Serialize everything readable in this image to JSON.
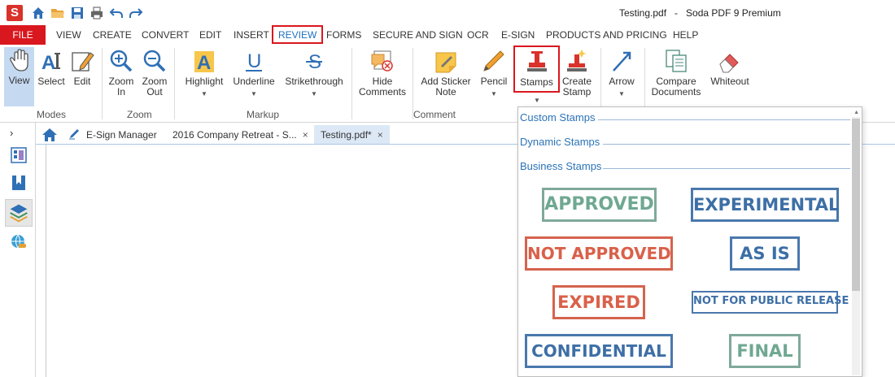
{
  "titlebar": {
    "logo": "S",
    "doc_title": "Testing.pdf   -   Soda PDF 9 Premium"
  },
  "menu": {
    "file": "FILE",
    "items": [
      "VIEW",
      "CREATE",
      "CONVERT",
      "EDIT",
      "INSERT",
      "REVIEW",
      "FORMS",
      "SECURE AND SIGN",
      "OCR",
      "E-SIGN",
      "PRODUCTS AND PRICING",
      "HELP"
    ],
    "active": "REVIEW"
  },
  "ribbon": {
    "view": "View",
    "select": "Select",
    "edit": "Edit",
    "zoom_in": [
      "Zoom",
      "In"
    ],
    "zoom_out": [
      "Zoom",
      "Out"
    ],
    "highlight": "Highlight",
    "underline": "Underline",
    "strikethrough": "Strikethrough",
    "hide_comments": [
      "Hide",
      "Comments"
    ],
    "add_sticker": [
      "Add Sticker",
      "Note"
    ],
    "pencil": "Pencil",
    "stamps": "Stamps",
    "create_stamp": [
      "Create",
      "Stamp"
    ],
    "arrow": "Arrow",
    "compare": [
      "Compare",
      "Documents"
    ],
    "whiteout": "Whiteout",
    "groups": {
      "modes": "Modes",
      "zoom": "Zoom",
      "markup": "Markup",
      "comment": "Comment"
    }
  },
  "tabs": {
    "esign": "E-Sign Manager",
    "retreat": "2016 Company Retreat - S...",
    "testing": "Testing.pdf*",
    "close": "×"
  },
  "stamps_dropdown": {
    "sections": [
      "Custom Stamps",
      "Dynamic Stamps",
      "Business Stamps"
    ],
    "stamps": [
      "APPROVED",
      "EXPERIMENTAL",
      "NOT APPROVED",
      "AS IS",
      "EXPIRED",
      "NOT FOR PUBLIC RELEASE",
      "CONFIDENTIAL",
      "FINAL"
    ]
  },
  "colors": {
    "accent_red": "#d9171e",
    "accent_blue": "#1e6fc2",
    "stamp_green": "#6fa892",
    "stamp_blue": "#3d6fa6",
    "stamp_red": "#d9614a"
  }
}
